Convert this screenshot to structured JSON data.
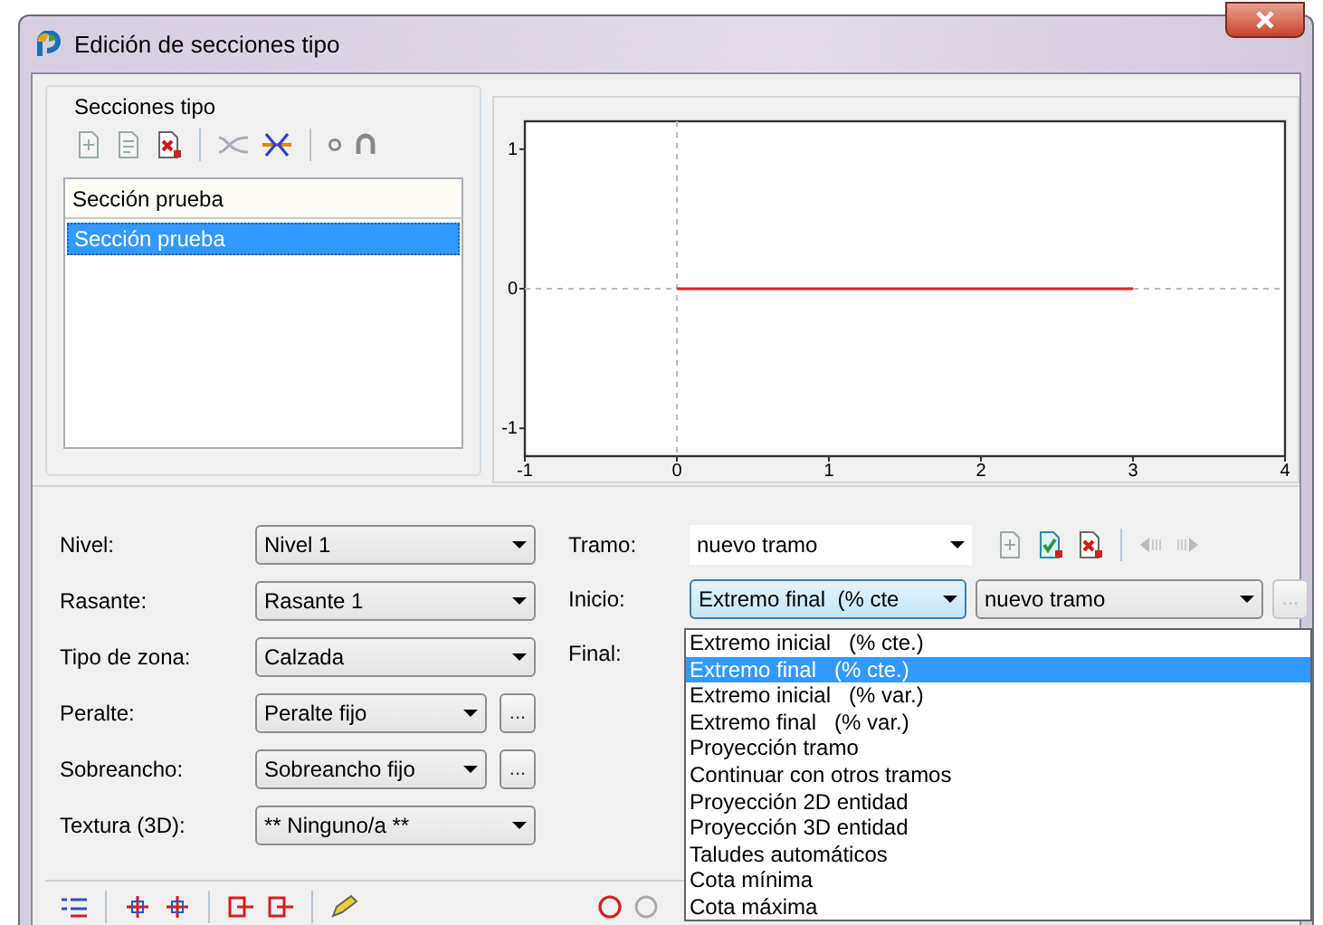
{
  "window": {
    "title": "Edición de secciones tipo"
  },
  "sections": {
    "title": "Secciones tipo",
    "name_field": "Sección prueba",
    "items": [
      {
        "label": "Sección prueba",
        "selected": true
      }
    ]
  },
  "profile": {
    "chart_data": {
      "type": "line",
      "x": [
        0,
        3
      ],
      "series": [
        {
          "color": "#e02020",
          "values": [
            0,
            0
          ]
        }
      ],
      "xlim": [
        -1,
        4
      ],
      "ylim": [
        -1.2,
        1.2
      ],
      "xticks": [
        -1,
        0,
        1,
        2,
        3,
        4
      ],
      "yticks": [
        -1,
        0,
        1
      ]
    }
  },
  "properties": [
    {
      "label": "Nivel:",
      "value": "Nivel 1"
    },
    {
      "label": "Rasante:",
      "value": "Rasante 1"
    },
    {
      "label": "Tipo de zona:",
      "value": "Calzada"
    },
    {
      "label": "Peralte:",
      "value": "Peralte fijo",
      "more": "..."
    },
    {
      "label": "Sobreancho:",
      "value": "Sobreancho fijo",
      "more": "..."
    },
    {
      "label": "Textura (3D):",
      "value": "** Ninguno/a **"
    }
  ],
  "tramo": {
    "label": "Tramo:",
    "value": "nuevo tramo"
  },
  "inicio": {
    "label": "Inicio:",
    "value": "Extremo final  (% cte",
    "reference": "nuevo tramo",
    "more": "...",
    "more_disabled": true,
    "open": true,
    "options": [
      {
        "label": "Extremo inicial   (% cte.)",
        "selected": false
      },
      {
        "label": "Extremo final   (% cte.)",
        "selected": true
      },
      {
        "label": "Extremo inicial   (% var.)",
        "selected": false
      },
      {
        "label": "Extremo final   (% var.)",
        "selected": false
      },
      {
        "label": "Proyección tramo",
        "selected": false
      },
      {
        "label": "Continuar con otros tramos",
        "selected": false
      },
      {
        "label": "Proyección 2D entidad",
        "selected": false
      },
      {
        "label": "Proyección 3D entidad",
        "selected": false
      },
      {
        "label": "Taludes automáticos",
        "selected": false
      },
      {
        "label": "Cota mínima",
        "selected": false
      },
      {
        "label": "Cota máxima",
        "selected": false
      }
    ]
  },
  "final": {
    "label": "Final:"
  }
}
